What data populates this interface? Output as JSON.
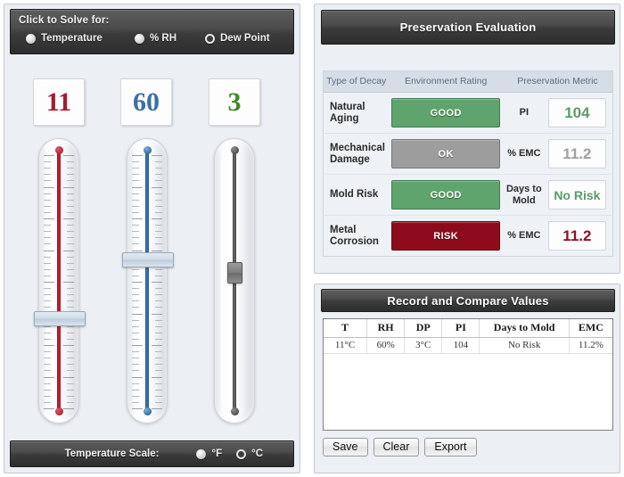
{
  "left": {
    "solve_label": "Click to Solve for:",
    "solve_options": [
      {
        "label": "Temperature",
        "selected": false
      },
      {
        "label": "% RH",
        "selected": false
      },
      {
        "label": "Dew Point",
        "selected": true
      }
    ],
    "readouts": {
      "temperature": "11",
      "humidity": "60",
      "dewpoint": "3"
    },
    "scale_label": "Temperature Scale:",
    "scale_options": [
      {
        "label": "°F",
        "selected": false
      },
      {
        "label": "°C",
        "selected": true
      }
    ]
  },
  "eval": {
    "title": "Preservation Evaluation",
    "headers": {
      "decay": "Type of Decay",
      "rating": "Environment Rating",
      "metric": "Preservation Metric"
    },
    "rows": [
      {
        "decay": "Natural Aging",
        "rating": "GOOD",
        "rating_color": "#5fa36d",
        "metric_label": "PI",
        "metric_value": "104",
        "metric_color": "#5b9b6a"
      },
      {
        "decay": "Mechanical Damage",
        "rating": "OK",
        "rating_color": "#9d9d9d",
        "metric_label": "% EMC",
        "metric_value": "11.2",
        "metric_color": "#a0a0a0"
      },
      {
        "decay": "Mold Risk",
        "rating": "GOOD",
        "rating_color": "#5fa36d",
        "metric_label": "Days to Mold",
        "metric_value": "No Risk",
        "metric_color": "#5b9b6a"
      },
      {
        "decay": "Metal Corrosion",
        "rating": "RISK",
        "rating_color": "#8e0b1c",
        "metric_label": "% EMC",
        "metric_value": "11.2",
        "metric_color": "#8e1123"
      }
    ]
  },
  "record": {
    "title": "Record and Compare Values",
    "columns": [
      "T",
      "RH",
      "DP",
      "PI",
      "Days to Mold",
      "EMC"
    ],
    "rows": [
      [
        "11°C",
        "60%",
        "3°C",
        "104",
        "No Risk",
        "11.2%"
      ]
    ],
    "buttons": [
      "Save",
      "Clear",
      "Export"
    ]
  }
}
